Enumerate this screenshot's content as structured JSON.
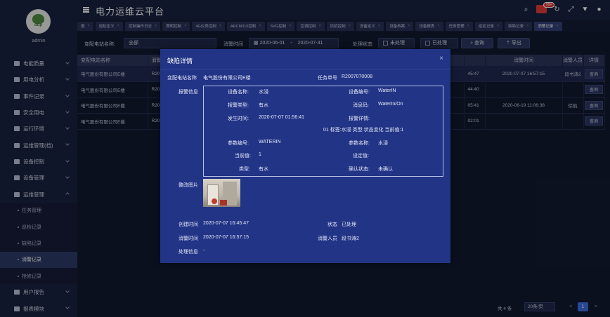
{
  "app": {
    "title": "电力运维云平台",
    "user": "admin",
    "logo_text": "dup",
    "notification_count": "99+"
  },
  "sidebar": {
    "items": [
      {
        "label": "电能质量",
        "icon": "power-quality-icon"
      },
      {
        "label": "用电分析",
        "icon": "chart-icon"
      },
      {
        "label": "事件记录",
        "icon": "event-icon"
      },
      {
        "label": "安全用电",
        "icon": "safety-icon"
      },
      {
        "label": "运行环境",
        "icon": "environment-icon"
      },
      {
        "label": "运维管理(档)",
        "icon": "user-manage-icon"
      },
      {
        "label": "设备控制",
        "icon": "control-icon"
      },
      {
        "label": "设备管理",
        "icon": "device-icon"
      },
      {
        "label": "运维管理",
        "icon": "ops-icon",
        "open": true
      }
    ],
    "subitems": [
      "任务管理",
      "巡检记录",
      "缺陷记录",
      "消警记录",
      "抢修记录"
    ],
    "active_sub": "消警记录",
    "bottom": [
      {
        "label": "用户报告",
        "icon": "report-icon"
      },
      {
        "label": "报表模块",
        "icon": "table-icon"
      }
    ]
  },
  "tabs": [
    "报",
    "巡检定义",
    "控制操作日志",
    "照明控制",
    "4G仪表控制",
    "ARCM310控制",
    "SVG控制",
    "空调控制",
    "风机控制",
    "设备定义",
    "设备档案",
    "设备报表",
    "任务管理",
    "巡检记录",
    "缺陷记录",
    "消警记录"
  ],
  "filter": {
    "station_label": "变配电站名称:",
    "station_value": "全部",
    "time_label": "消警时间",
    "date_from": "2020-06-01",
    "date_sep": "-",
    "date_to": "2020-07-31",
    "status_label": "处理状态",
    "status_unprocessed": "未处理",
    "status_processed": "已处理",
    "query": "查询",
    "export": "导出"
  },
  "table": {
    "headers": [
      "变配电站名称",
      "消警",
      "",
      "",
      "",
      "",
      "",
      "消警时间",
      "消警人员",
      "详情"
    ],
    "rows": [
      {
        "station": "电气股份有限公司E楼",
        "code": "R20",
        "time_a": "45:47",
        "time": "2020-07-07 16:57:15",
        "person": "段书涛2",
        "btn": "查询"
      },
      {
        "station": "电气股份有限公司E楼",
        "code": "R20",
        "time_a": "44:40",
        "time": "",
        "person": "",
        "btn": "查询"
      },
      {
        "station": "电气股份有限公司E楼",
        "code": "R20",
        "time_a": "05:41",
        "time": "2020-06-19 11:06:38",
        "person": "徐航",
        "btn": "查询"
      },
      {
        "station": "电气股份有限公司E楼",
        "code": "R20",
        "time_a": "02:01",
        "time": "",
        "person": "",
        "btn": "查询"
      }
    ]
  },
  "pager": {
    "total": "共 4 条",
    "size": "20条/页",
    "prev": "<",
    "page": "1",
    "next": ">"
  },
  "modal": {
    "title": "缺陷详情",
    "close": "×",
    "station_label": "变配电站名称",
    "station": "电气股份有限公司E楼",
    "task_label": "任务单号",
    "task": "R2007070008",
    "alarm_label": "报警信息",
    "device_name_label": "设备名称:",
    "device_name": "水浸",
    "device_code_label": "设备编号:",
    "device_code": "WaterIN",
    "alarm_type_label": "报警类型:",
    "alarm_type": "有水",
    "msg_code_label": "消息码:",
    "msg_code": "WaterIn/On",
    "occur_label": "发生时间:",
    "occur": "2020-07-07 01:56:41",
    "detail_label": "报警详情:",
    "detail": "01 标签:水浸 类型:状态变化 当前值:1",
    "param_code_label": "参数编号:",
    "param_code": "WATERIN",
    "param_name_label": "参数名称:",
    "param_name": "水浸",
    "current_label": "当前值:",
    "current": "1",
    "set_label": "设定值:",
    "set": "",
    "type_label": "类型:",
    "type": "有水",
    "confirm_label": "确认状态:",
    "confirm": "未确认",
    "photo_label": "整改图片",
    "created_label": "创建时间",
    "created": "2020-07-07 16:45:47",
    "status_label": "状态",
    "status": "已处理",
    "cleared_label": "消警时间",
    "cleared": "2020-07-07 16:57:15",
    "person_label": "消警人员",
    "person": "段书涛2",
    "process_label": "处理信息",
    "process": "-"
  }
}
